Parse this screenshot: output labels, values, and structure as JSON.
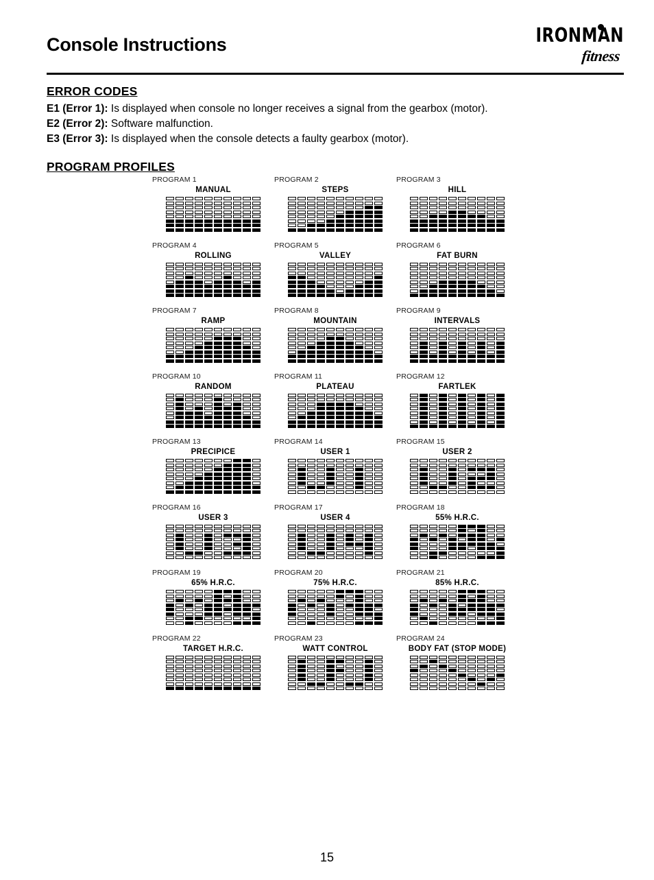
{
  "header": {
    "title": "Console Instructions",
    "brand_top": "IRONMAN",
    "brand_bottom": "fitness"
  },
  "error_codes": {
    "heading": "ERROR CODES",
    "items": [
      {
        "code": "E1 (Error 1):",
        "text": "Is displayed when console no longer receives a signal from the gearbox (motor)."
      },
      {
        "code": "E2 (Error 2):",
        "text": "Software malfunction."
      },
      {
        "code": "E3 (Error 3):",
        "text": "Is displayed when the console detects a faulty gearbox (motor)."
      }
    ]
  },
  "program_profiles": {
    "heading": "PROGRAM PROFILES",
    "grid": {
      "columns": 10,
      "rows": 8
    },
    "programs": [
      {
        "number": "PROGRAM 1",
        "name": "MANUAL",
        "heights": [
          3,
          3,
          3,
          3,
          3,
          3,
          3,
          3,
          3,
          3
        ]
      },
      {
        "number": "PROGRAM 2",
        "name": "STEPS",
        "heights": [
          1,
          1,
          2,
          2,
          3,
          4,
          5,
          5,
          6,
          6
        ]
      },
      {
        "number": "PROGRAM 3",
        "name": "HILL",
        "heights": [
          3,
          3,
          4,
          4,
          5,
          5,
          4,
          4,
          3,
          3
        ]
      },
      {
        "number": "PROGRAM 4",
        "name": "ROLLING",
        "heights": [
          3,
          4,
          5,
          4,
          3,
          4,
          5,
          4,
          3,
          4
        ]
      },
      {
        "number": "PROGRAM 5",
        "name": "VALLEY",
        "heights": [
          5,
          5,
          4,
          3,
          2,
          1,
          2,
          3,
          4,
          5
        ]
      },
      {
        "number": "PROGRAM 6",
        "name": "FAT BURN",
        "heights": [
          1,
          2,
          3,
          4,
          4,
          4,
          4,
          3,
          2,
          1
        ]
      },
      {
        "number": "PROGRAM 7",
        "name": "RAMP",
        "heights": [
          2,
          2,
          3,
          4,
          5,
          6,
          6,
          6,
          4,
          3
        ]
      },
      {
        "number": "PROGRAM 8",
        "name": "MOUNTAIN",
        "heights": [
          2,
          3,
          4,
          5,
          6,
          6,
          5,
          4,
          3,
          2
        ]
      },
      {
        "number": "PROGRAM 9",
        "name": "INTERVALS",
        "heights": [
          2,
          5,
          2,
          5,
          2,
          5,
          2,
          5,
          2,
          5
        ]
      },
      {
        "number": "PROGRAM 10",
        "name": "RANDOM",
        "heights": [
          2,
          7,
          4,
          5,
          3,
          7,
          5,
          6,
          3,
          2
        ]
      },
      {
        "number": "PROGRAM 11",
        "name": "PLATEAU",
        "heights": [
          2,
          3,
          4,
          6,
          6,
          6,
          6,
          5,
          4,
          3
        ]
      },
      {
        "number": "PROGRAM 12",
        "name": "FARTLEK",
        "heights": [
          1,
          8,
          1,
          8,
          1,
          8,
          1,
          8,
          1,
          8
        ]
      },
      {
        "number": "PROGRAM 13",
        "name": "PRECIPICE",
        "heights": [
          1,
          2,
          3,
          4,
          5,
          6,
          7,
          8,
          8,
          2
        ]
      },
      {
        "number": "PROGRAM 14",
        "name": "USER 1",
        "cells": [
          [
            0,
            0,
            0,
            0,
            0,
            0,
            0,
            0,
            0,
            0
          ],
          [
            0,
            0,
            0,
            0,
            0,
            0,
            0,
            0,
            0,
            0
          ],
          [
            0,
            1,
            0,
            0,
            1,
            0,
            0,
            1,
            0,
            0
          ],
          [
            0,
            1,
            0,
            0,
            1,
            0,
            0,
            1,
            0,
            0
          ],
          [
            0,
            1,
            0,
            0,
            1,
            0,
            0,
            1,
            0,
            0
          ],
          [
            0,
            1,
            0,
            0,
            1,
            0,
            0,
            1,
            0,
            0
          ],
          [
            0,
            0,
            1,
            1,
            0,
            0,
            0,
            1,
            0,
            0
          ],
          [
            0,
            0,
            0,
            0,
            0,
            0,
            0,
            0,
            0,
            0
          ]
        ]
      },
      {
        "number": "PROGRAM 15",
        "name": "USER 2",
        "cells": [
          [
            0,
            0,
            0,
            0,
            0,
            0,
            0,
            0,
            0,
            0
          ],
          [
            0,
            0,
            0,
            0,
            0,
            0,
            0,
            0,
            0,
            0
          ],
          [
            0,
            1,
            0,
            0,
            1,
            0,
            1,
            1,
            1,
            0
          ],
          [
            0,
            1,
            0,
            0,
            1,
            0,
            0,
            0,
            1,
            0
          ],
          [
            0,
            1,
            0,
            0,
            1,
            0,
            1,
            1,
            1,
            0
          ],
          [
            0,
            1,
            0,
            0,
            1,
            0,
            1,
            0,
            0,
            0
          ],
          [
            0,
            0,
            1,
            1,
            0,
            0,
            1,
            1,
            1,
            0
          ],
          [
            0,
            0,
            0,
            0,
            0,
            0,
            0,
            0,
            0,
            0
          ]
        ]
      },
      {
        "number": "PROGRAM 16",
        "name": "USER 3",
        "cells": [
          [
            0,
            0,
            0,
            0,
            0,
            0,
            0,
            0,
            0,
            0
          ],
          [
            0,
            0,
            0,
            0,
            0,
            0,
            0,
            0,
            0,
            0
          ],
          [
            0,
            1,
            0,
            0,
            1,
            0,
            1,
            1,
            1,
            0
          ],
          [
            0,
            1,
            0,
            0,
            1,
            0,
            0,
            0,
            1,
            0
          ],
          [
            0,
            1,
            0,
            0,
            1,
            0,
            0,
            1,
            1,
            0
          ],
          [
            0,
            1,
            0,
            0,
            1,
            0,
            0,
            0,
            1,
            0
          ],
          [
            0,
            0,
            1,
            1,
            0,
            0,
            1,
            1,
            1,
            0
          ],
          [
            0,
            0,
            0,
            0,
            0,
            0,
            0,
            0,
            0,
            0
          ]
        ]
      },
      {
        "number": "PROGRAM 17",
        "name": "USER 4",
        "cells": [
          [
            0,
            0,
            0,
            0,
            0,
            0,
            0,
            0,
            0,
            0
          ],
          [
            0,
            0,
            0,
            0,
            0,
            0,
            0,
            0,
            0,
            0
          ],
          [
            0,
            1,
            0,
            0,
            1,
            0,
            1,
            0,
            1,
            0
          ],
          [
            0,
            1,
            0,
            0,
            1,
            0,
            1,
            0,
            1,
            0
          ],
          [
            0,
            1,
            0,
            0,
            1,
            0,
            1,
            1,
            1,
            0
          ],
          [
            0,
            1,
            0,
            0,
            1,
            0,
            0,
            0,
            1,
            0
          ],
          [
            0,
            0,
            1,
            1,
            0,
            0,
            0,
            0,
            1,
            0
          ],
          [
            0,
            0,
            0,
            0,
            0,
            0,
            0,
            0,
            0,
            0
          ]
        ]
      },
      {
        "number": "PROGRAM 18",
        "name": "55% H.R.C.",
        "cells": [
          [
            0,
            0,
            0,
            0,
            0,
            1,
            1,
            1,
            0,
            0
          ],
          [
            0,
            0,
            0,
            0,
            0,
            1,
            0,
            1,
            0,
            0
          ],
          [
            0,
            1,
            0,
            1,
            0,
            1,
            1,
            1,
            0,
            0
          ],
          [
            1,
            0,
            1,
            0,
            1,
            0,
            1,
            1,
            0,
            1
          ],
          [
            1,
            0,
            0,
            0,
            1,
            1,
            1,
            1,
            1,
            0
          ],
          [
            1,
            0,
            0,
            0,
            1,
            1,
            0,
            1,
            1,
            1
          ],
          [
            0,
            0,
            1,
            1,
            0,
            0,
            0,
            0,
            0,
            1
          ],
          [
            0,
            0,
            1,
            0,
            0,
            0,
            0,
            1,
            1,
            1
          ]
        ]
      },
      {
        "number": "PROGRAM 19",
        "name": "65% H.R.C.",
        "cells": [
          [
            0,
            0,
            0,
            0,
            0,
            1,
            1,
            1,
            0,
            0
          ],
          [
            0,
            0,
            0,
            0,
            0,
            1,
            0,
            1,
            0,
            0
          ],
          [
            0,
            1,
            0,
            1,
            0,
            1,
            1,
            1,
            0,
            0
          ],
          [
            1,
            0,
            1,
            0,
            1,
            1,
            0,
            1,
            1,
            1
          ],
          [
            1,
            0,
            0,
            0,
            1,
            1,
            1,
            1,
            1,
            0
          ],
          [
            1,
            0,
            0,
            0,
            1,
            1,
            0,
            1,
            1,
            1
          ],
          [
            0,
            0,
            1,
            1,
            0,
            0,
            0,
            0,
            0,
            1
          ],
          [
            0,
            0,
            1,
            0,
            0,
            0,
            0,
            1,
            1,
            1
          ]
        ]
      },
      {
        "number": "PROGRAM 20",
        "name": "75% H.R.C.",
        "cells": [
          [
            0,
            0,
            0,
            0,
            0,
            1,
            1,
            1,
            0,
            0
          ],
          [
            0,
            0,
            0,
            0,
            0,
            1,
            0,
            1,
            0,
            0
          ],
          [
            0,
            1,
            0,
            1,
            0,
            0,
            0,
            1,
            0,
            0
          ],
          [
            1,
            0,
            1,
            0,
            1,
            0,
            1,
            1,
            1,
            1
          ],
          [
            1,
            0,
            0,
            0,
            1,
            0,
            0,
            1,
            1,
            0
          ],
          [
            1,
            0,
            0,
            0,
            1,
            0,
            0,
            1,
            1,
            1
          ],
          [
            0,
            0,
            0,
            0,
            0,
            0,
            0,
            0,
            0,
            1
          ],
          [
            0,
            0,
            1,
            0,
            0,
            0,
            0,
            1,
            1,
            1
          ]
        ]
      },
      {
        "number": "PROGRAM 21",
        "name": "85% H.R.C.",
        "cells": [
          [
            0,
            0,
            0,
            0,
            0,
            1,
            1,
            1,
            0,
            0
          ],
          [
            0,
            0,
            0,
            0,
            0,
            1,
            0,
            1,
            0,
            0
          ],
          [
            0,
            1,
            0,
            1,
            0,
            1,
            1,
            1,
            0,
            0
          ],
          [
            1,
            0,
            1,
            0,
            1,
            0,
            1,
            1,
            1,
            1
          ],
          [
            1,
            0,
            0,
            0,
            1,
            1,
            1,
            1,
            1,
            0
          ],
          [
            1,
            0,
            0,
            0,
            1,
            1,
            0,
            1,
            1,
            1
          ],
          [
            0,
            1,
            0,
            0,
            0,
            0,
            0,
            0,
            0,
            1
          ],
          [
            0,
            0,
            1,
            0,
            0,
            0,
            0,
            1,
            1,
            1
          ]
        ]
      },
      {
        "number": "PROGRAM 22",
        "name": "TARGET H.R.C.",
        "heights": [
          1,
          1,
          1,
          1,
          1,
          1,
          1,
          1,
          1,
          1
        ]
      },
      {
        "number": "PROGRAM 23",
        "name": "WATT CONTROL",
        "cells": [
          [
            0,
            0,
            0,
            0,
            0,
            0,
            0,
            0,
            0,
            0
          ],
          [
            0,
            1,
            0,
            0,
            1,
            1,
            0,
            0,
            1,
            0
          ],
          [
            0,
            1,
            0,
            0,
            1,
            0,
            0,
            0,
            1,
            0
          ],
          [
            0,
            1,
            0,
            0,
            1,
            1,
            0,
            0,
            1,
            0
          ],
          [
            0,
            1,
            0,
            0,
            1,
            0,
            0,
            0,
            1,
            0
          ],
          [
            0,
            1,
            0,
            0,
            1,
            0,
            0,
            0,
            1,
            0
          ],
          [
            0,
            0,
            1,
            1,
            0,
            0,
            1,
            1,
            0,
            0
          ],
          [
            0,
            0,
            0,
            0,
            0,
            0,
            0,
            0,
            0,
            0
          ]
        ]
      },
      {
        "number": "PROGRAM 24",
        "name": "BODY FAT (STOP MODE)",
        "cells": [
          [
            0,
            0,
            0,
            0,
            0,
            0,
            0,
            0,
            0,
            0
          ],
          [
            0,
            0,
            1,
            0,
            0,
            0,
            0,
            0,
            0,
            0
          ],
          [
            0,
            1,
            0,
            1,
            0,
            0,
            0,
            0,
            0,
            0
          ],
          [
            1,
            0,
            0,
            0,
            1,
            0,
            0,
            0,
            0,
            0
          ],
          [
            0,
            0,
            0,
            0,
            0,
            1,
            0,
            0,
            0,
            1
          ],
          [
            0,
            0,
            0,
            0,
            0,
            0,
            1,
            0,
            1,
            0
          ],
          [
            0,
            0,
            0,
            0,
            0,
            0,
            0,
            1,
            0,
            0
          ],
          [
            0,
            0,
            0,
            0,
            0,
            0,
            0,
            0,
            0,
            0
          ]
        ]
      }
    ]
  },
  "footer": {
    "page_number": "15"
  }
}
